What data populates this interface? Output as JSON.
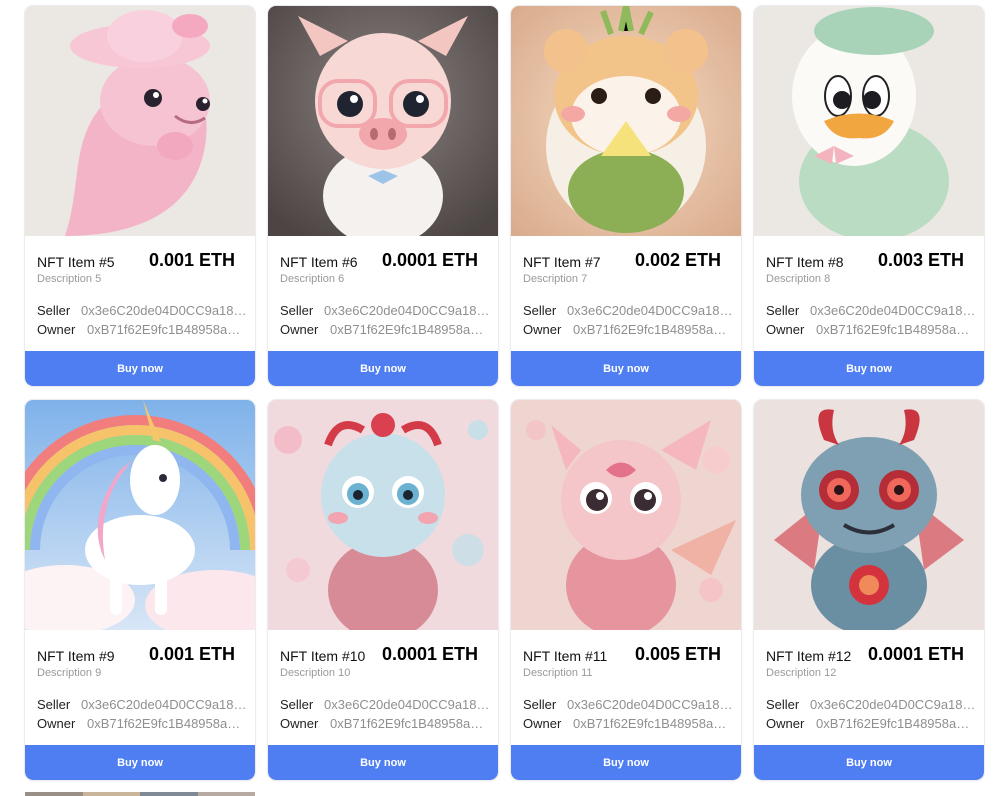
{
  "grid": {
    "cards": [
      {
        "name": "NFT Item #5",
        "price": "0.001 ETH",
        "description": "Description 5",
        "seller_label": "Seller",
        "seller": "0x3e6C20de04D0CC9a182...",
        "owner_label": "Owner",
        "owner": "0xB71f62E9fc1B48958aa7...",
        "buy_label": "Buy now",
        "art": "pink-dolphin-with-hat",
        "palette": [
          "#e9e5e1",
          "#f7b9cb"
        ]
      },
      {
        "name": "NFT Item #6",
        "price": "0.0001 ETH",
        "description": "Description 6",
        "seller_label": "Seller",
        "seller": "0x3e6C20de04D0CC9a182...",
        "owner_label": "Owner",
        "owner": "0xB71f62E9fc1B48958aa7...",
        "buy_label": "Buy now",
        "art": "piglet-with-glasses",
        "palette": [
          "#6b6463",
          "#f4d2cf"
        ]
      },
      {
        "name": "NFT Item #7",
        "price": "0.002 ETH",
        "description": "Description 7",
        "seller_label": "Seller",
        "seller": "0x3e6C20de04D0CC9a182...",
        "owner_label": "Owner",
        "owner": "0xB71f62E9fc1B48958aa7...",
        "buy_label": "Buy now",
        "art": "hamster-with-melon",
        "palette": [
          "#e9c8ad",
          "#f3d2a0"
        ]
      },
      {
        "name": "NFT Item #8",
        "price": "0.003 ETH",
        "description": "Description 8",
        "seller_label": "Seller",
        "seller": "0x3e6C20de04D0CC9a182...",
        "owner_label": "Owner",
        "owner": "0xB71f62E9fc1B48958aa7...",
        "buy_label": "Buy now",
        "art": "duckling-in-green-coat",
        "palette": [
          "#ece9e6",
          "#bfe0c8"
        ]
      },
      {
        "name": "NFT Item #9",
        "price": "0.001 ETH",
        "description": "Description 9",
        "seller_label": "Seller",
        "seller": "0x3e6C20de04D0CC9a182...",
        "owner_label": "Owner",
        "owner": "0xB71f62E9fc1B48958aa7...",
        "buy_label": "Buy now",
        "art": "rainbow-unicorn",
        "palette": [
          "#a9c9ef",
          "#ffffff"
        ]
      },
      {
        "name": "NFT Item #10",
        "price": "0.0001 ETH",
        "description": "Description 10",
        "seller_label": "Seller",
        "seller": "0x3e6C20de04D0CC9a182...",
        "owner_label": "Owner",
        "owner": "0xB71f62E9fc1B48958aa7...",
        "buy_label": "Buy now",
        "art": "baby-dragon-blue-red",
        "palette": [
          "#f2d9dc",
          "#bcdde7"
        ]
      },
      {
        "name": "NFT Item #11",
        "price": "0.005 ETH",
        "description": "Description 11",
        "seller_label": "Seller",
        "seller": "0x3e6C20de04D0CC9a182...",
        "owner_label": "Owner",
        "owner": "0xB71f62E9fc1B48958aa7...",
        "buy_label": "Buy now",
        "art": "baby-dragon-pink",
        "palette": [
          "#efd3cf",
          "#f2b3b6"
        ]
      },
      {
        "name": "NFT Item #12",
        "price": "0.0001 ETH",
        "description": "Description 12",
        "seller_label": "Seller",
        "seller": "0x3e6C20de04D0CC9a182...",
        "owner_label": "Owner",
        "owner": "0xB71f62E9fc1B48958aa7...",
        "buy_label": "Buy now",
        "art": "mech-dragon-red-blue",
        "palette": [
          "#e9dedd",
          "#6c93a8"
        ]
      }
    ]
  },
  "colors": {
    "button": "#4f7ef2",
    "button_text": "#ffffff",
    "muted_text": "#8f8f8f"
  }
}
